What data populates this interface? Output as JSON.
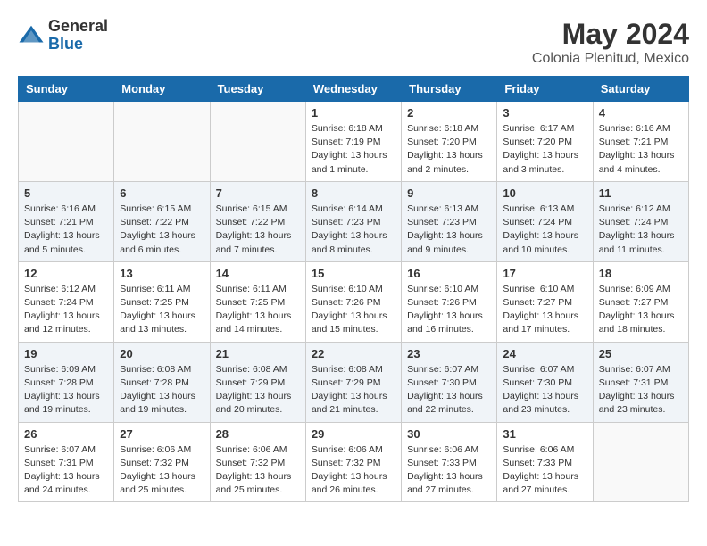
{
  "header": {
    "logo_general": "General",
    "logo_blue": "Blue",
    "title": "May 2024",
    "subtitle": "Colonia Plenitud, Mexico"
  },
  "days_of_week": [
    "Sunday",
    "Monday",
    "Tuesday",
    "Wednesday",
    "Thursday",
    "Friday",
    "Saturday"
  ],
  "weeks": [
    [
      {
        "day": "",
        "info": ""
      },
      {
        "day": "",
        "info": ""
      },
      {
        "day": "",
        "info": ""
      },
      {
        "day": "1",
        "info": "Sunrise: 6:18 AM\nSunset: 7:19 PM\nDaylight: 13 hours\nand 1 minute."
      },
      {
        "day": "2",
        "info": "Sunrise: 6:18 AM\nSunset: 7:20 PM\nDaylight: 13 hours\nand 2 minutes."
      },
      {
        "day": "3",
        "info": "Sunrise: 6:17 AM\nSunset: 7:20 PM\nDaylight: 13 hours\nand 3 minutes."
      },
      {
        "day": "4",
        "info": "Sunrise: 6:16 AM\nSunset: 7:21 PM\nDaylight: 13 hours\nand 4 minutes."
      }
    ],
    [
      {
        "day": "5",
        "info": "Sunrise: 6:16 AM\nSunset: 7:21 PM\nDaylight: 13 hours\nand 5 minutes."
      },
      {
        "day": "6",
        "info": "Sunrise: 6:15 AM\nSunset: 7:22 PM\nDaylight: 13 hours\nand 6 minutes."
      },
      {
        "day": "7",
        "info": "Sunrise: 6:15 AM\nSunset: 7:22 PM\nDaylight: 13 hours\nand 7 minutes."
      },
      {
        "day": "8",
        "info": "Sunrise: 6:14 AM\nSunset: 7:23 PM\nDaylight: 13 hours\nand 8 minutes."
      },
      {
        "day": "9",
        "info": "Sunrise: 6:13 AM\nSunset: 7:23 PM\nDaylight: 13 hours\nand 9 minutes."
      },
      {
        "day": "10",
        "info": "Sunrise: 6:13 AM\nSunset: 7:24 PM\nDaylight: 13 hours\nand 10 minutes."
      },
      {
        "day": "11",
        "info": "Sunrise: 6:12 AM\nSunset: 7:24 PM\nDaylight: 13 hours\nand 11 minutes."
      }
    ],
    [
      {
        "day": "12",
        "info": "Sunrise: 6:12 AM\nSunset: 7:24 PM\nDaylight: 13 hours\nand 12 minutes."
      },
      {
        "day": "13",
        "info": "Sunrise: 6:11 AM\nSunset: 7:25 PM\nDaylight: 13 hours\nand 13 minutes."
      },
      {
        "day": "14",
        "info": "Sunrise: 6:11 AM\nSunset: 7:25 PM\nDaylight: 13 hours\nand 14 minutes."
      },
      {
        "day": "15",
        "info": "Sunrise: 6:10 AM\nSunset: 7:26 PM\nDaylight: 13 hours\nand 15 minutes."
      },
      {
        "day": "16",
        "info": "Sunrise: 6:10 AM\nSunset: 7:26 PM\nDaylight: 13 hours\nand 16 minutes."
      },
      {
        "day": "17",
        "info": "Sunrise: 6:10 AM\nSunset: 7:27 PM\nDaylight: 13 hours\nand 17 minutes."
      },
      {
        "day": "18",
        "info": "Sunrise: 6:09 AM\nSunset: 7:27 PM\nDaylight: 13 hours\nand 18 minutes."
      }
    ],
    [
      {
        "day": "19",
        "info": "Sunrise: 6:09 AM\nSunset: 7:28 PM\nDaylight: 13 hours\nand 19 minutes."
      },
      {
        "day": "20",
        "info": "Sunrise: 6:08 AM\nSunset: 7:28 PM\nDaylight: 13 hours\nand 19 minutes."
      },
      {
        "day": "21",
        "info": "Sunrise: 6:08 AM\nSunset: 7:29 PM\nDaylight: 13 hours\nand 20 minutes."
      },
      {
        "day": "22",
        "info": "Sunrise: 6:08 AM\nSunset: 7:29 PM\nDaylight: 13 hours\nand 21 minutes."
      },
      {
        "day": "23",
        "info": "Sunrise: 6:07 AM\nSunset: 7:30 PM\nDaylight: 13 hours\nand 22 minutes."
      },
      {
        "day": "24",
        "info": "Sunrise: 6:07 AM\nSunset: 7:30 PM\nDaylight: 13 hours\nand 23 minutes."
      },
      {
        "day": "25",
        "info": "Sunrise: 6:07 AM\nSunset: 7:31 PM\nDaylight: 13 hours\nand 23 minutes."
      }
    ],
    [
      {
        "day": "26",
        "info": "Sunrise: 6:07 AM\nSunset: 7:31 PM\nDaylight: 13 hours\nand 24 minutes."
      },
      {
        "day": "27",
        "info": "Sunrise: 6:06 AM\nSunset: 7:32 PM\nDaylight: 13 hours\nand 25 minutes."
      },
      {
        "day": "28",
        "info": "Sunrise: 6:06 AM\nSunset: 7:32 PM\nDaylight: 13 hours\nand 25 minutes."
      },
      {
        "day": "29",
        "info": "Sunrise: 6:06 AM\nSunset: 7:32 PM\nDaylight: 13 hours\nand 26 minutes."
      },
      {
        "day": "30",
        "info": "Sunrise: 6:06 AM\nSunset: 7:33 PM\nDaylight: 13 hours\nand 27 minutes."
      },
      {
        "day": "31",
        "info": "Sunrise: 6:06 AM\nSunset: 7:33 PM\nDaylight: 13 hours\nand 27 minutes."
      },
      {
        "day": "",
        "info": ""
      }
    ]
  ]
}
